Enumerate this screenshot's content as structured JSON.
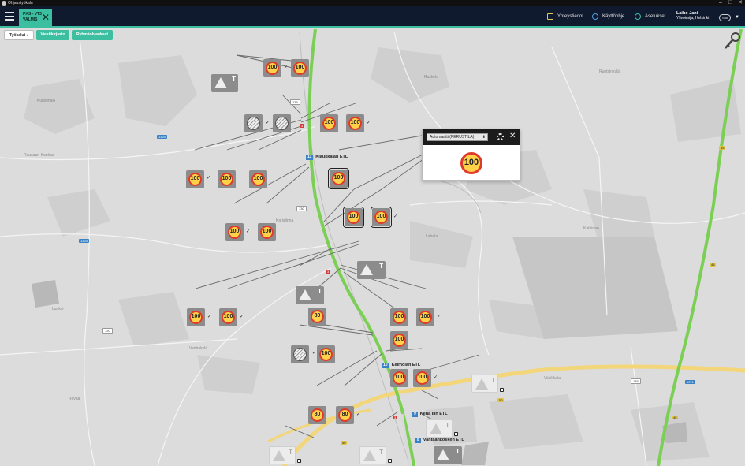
{
  "window": {
    "title": "Ohjaustyökalu",
    "controls": [
      "–",
      "□",
      "✕"
    ]
  },
  "header": {
    "project_tab": {
      "line1": "PKS - VT3",
      "line2": "VALMIS"
    },
    "links": [
      {
        "label": "Yhteystiedot",
        "icon": "contact-card-icon"
      },
      {
        "label": "Käyttöohje",
        "icon": "info-icon"
      },
      {
        "label": "Asetukset",
        "icon": "globe-settings-icon"
      }
    ],
    "user": {
      "name": "Laiho Jani",
      "role": "Ylivoimija, Helsinki"
    },
    "language": "Suo"
  },
  "toolbar": {
    "tools": "Työkalut ↓",
    "messages": "Viestikirjasto",
    "groups": "Ryhmäohjaukset"
  },
  "popup": {
    "mode": "Automaatti (PERUSTILA)",
    "speed": "100"
  },
  "road_labels": [
    {
      "num": "11",
      "name": "Klaukkalan ETL"
    },
    {
      "num": "10",
      "name": "Keimolan ETL"
    },
    {
      "num": "9",
      "name": "Kehä IIIn ETL"
    },
    {
      "num": "8",
      "name": "Vantaankosken ETL"
    }
  ],
  "road_shields": [
    "139",
    "1324",
    "1324",
    "130",
    "120",
    "135",
    "1371",
    "45",
    "45",
    "45",
    "50",
    "50",
    "3",
    "3",
    "3"
  ],
  "signs": [
    "100",
    "100",
    "100",
    "100",
    "100",
    "100",
    "100",
    "100",
    "100",
    "100",
    "100",
    "100",
    "100",
    "100",
    "100",
    "100",
    "80",
    "100",
    "100",
    "100",
    "100",
    "100",
    "80",
    "80"
  ],
  "colors": {
    "accent": "#3cbfa0",
    "topbar": "#101a2e",
    "sign_ring": "#e03b2a",
    "sign_fill": "#ffd24a",
    "road_green": "#7ccf55",
    "road_yellow": "#f2d679"
  }
}
